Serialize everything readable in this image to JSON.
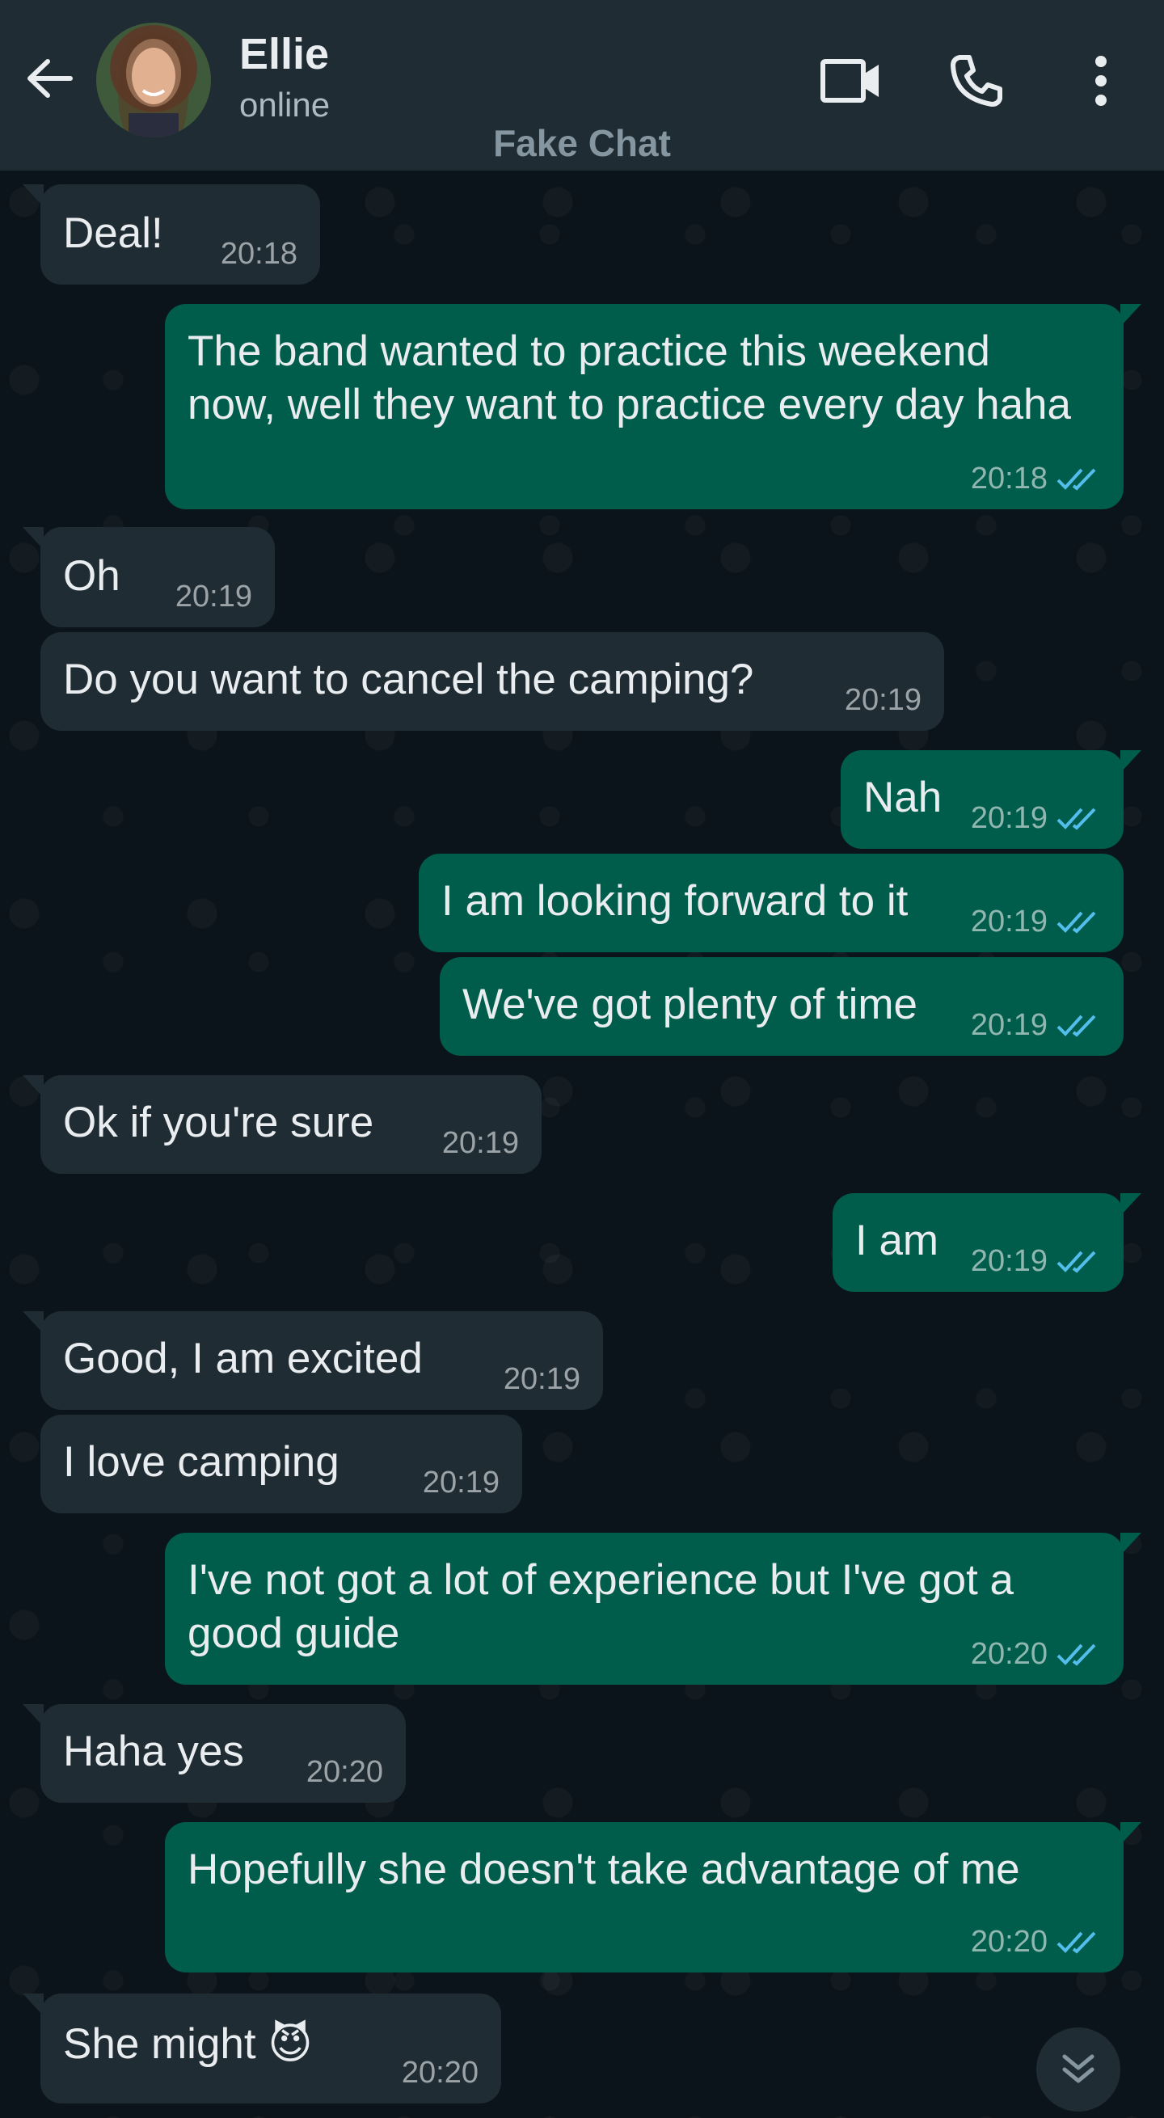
{
  "header": {
    "contact_name": "Ellie",
    "status": "online",
    "watermark": "Fake Chat",
    "icons": [
      "back-arrow-icon",
      "video-call-icon",
      "phone-icon",
      "more-options-icon"
    ]
  },
  "colors": {
    "header_bg": "#1f2c34",
    "incoming_bubble": "#1f2c34",
    "outgoing_bubble": "#005c4b",
    "read_tick": "#53bdeb",
    "background": "#0b141a"
  },
  "messages": [
    {
      "dir": "in",
      "text": "Deal!",
      "time": "20:18"
    },
    {
      "dir": "out",
      "text": "The band wanted to practice this weekend now, well they want to practice every day haha",
      "time": "20:18",
      "read": true
    },
    {
      "dir": "in",
      "text": "Oh",
      "time": "20:19"
    },
    {
      "dir": "in",
      "text": "Do you want to cancel the camping?",
      "time": "20:19"
    },
    {
      "dir": "out",
      "text": "Nah",
      "time": "20:19",
      "read": true
    },
    {
      "dir": "out",
      "text": "I am looking forward to it",
      "time": "20:19",
      "read": true
    },
    {
      "dir": "out",
      "text": "We've got plenty of time",
      "time": "20:19",
      "read": true
    },
    {
      "dir": "in",
      "text": "Ok if you're sure",
      "time": "20:19"
    },
    {
      "dir": "out",
      "text": "I am",
      "time": "20:19",
      "read": true
    },
    {
      "dir": "in",
      "text": "Good, I am excited",
      "time": "20:19"
    },
    {
      "dir": "in",
      "text": "I love camping",
      "time": "20:19"
    },
    {
      "dir": "out",
      "text": "I've not got a lot of experience but I've got a good guide",
      "time": "20:20",
      "read": true
    },
    {
      "dir": "in",
      "text": "Haha yes",
      "time": "20:20"
    },
    {
      "dir": "out",
      "text": "Hopefully she doesn't take advantage of me",
      "time": "20:20",
      "read": true
    },
    {
      "dir": "in",
      "text": "She might 😈",
      "time": "20:20"
    }
  ]
}
